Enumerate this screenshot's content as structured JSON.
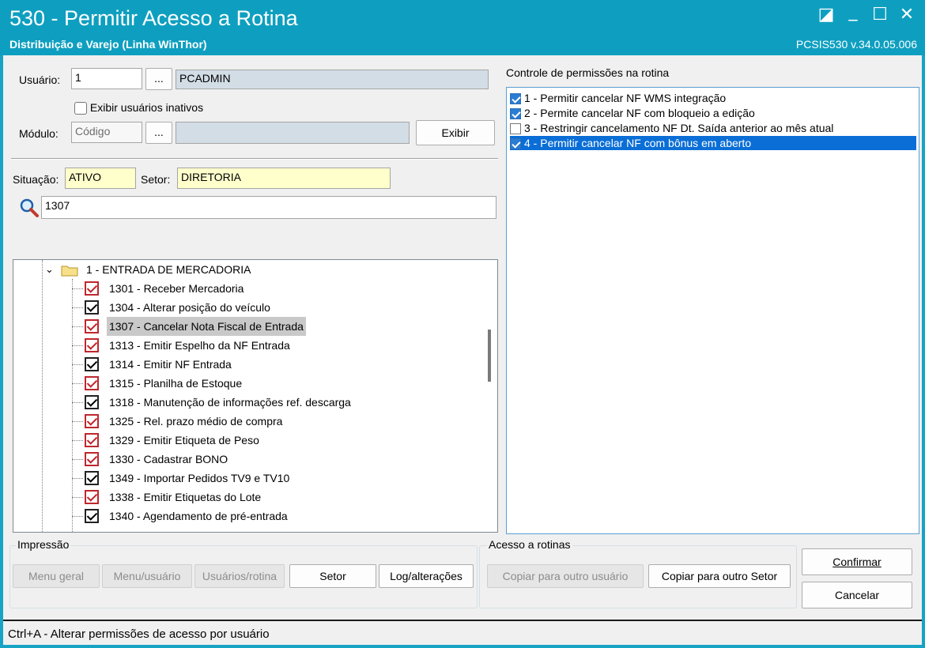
{
  "window": {
    "title": "530 - Permitir Acesso a Rotina",
    "subtitle": "Distribuição e Varejo (Linha WinThor)",
    "version": "PCSIS530  v.34.0.05.006",
    "controls": {
      "restore_icon": "◪",
      "minimize_icon": "_",
      "maximize_icon": "☐",
      "close_icon": "✕"
    }
  },
  "filters": {
    "usuario_label": "Usuário:",
    "usuario_code": "1",
    "ellipsis": "...",
    "usuario_name": "PCADMIN",
    "inactive_label": "Exibir usuários inativos",
    "modulo_label": "Módulo:",
    "modulo_placeholder": "Código",
    "modulo_name": "",
    "exibir_button": "Exibir",
    "situacao_label": "Situação:",
    "situacao_value": "ATIVO",
    "setor_label": "Setor:",
    "setor_value": "DIRETORIA",
    "search_value": "1307"
  },
  "tree": {
    "folder_label": "1 - ENTRADA DE MERCADORIA",
    "items": [
      {
        "label": "1301 - Receber Mercadoria",
        "style": "red"
      },
      {
        "label": "1304 - Alterar posição do veículo",
        "style": "black"
      },
      {
        "label": "1307 - Cancelar Nota Fiscal de  Entrada",
        "style": "red"
      },
      {
        "label": "1313 - Emitir Espelho da NF Entrada",
        "style": "red"
      },
      {
        "label": "1314 - Emitir NF Entrada",
        "style": "black"
      },
      {
        "label": "1315 - Planilha de Estoque",
        "style": "red"
      },
      {
        "label": "1318 - Manutenção de informações ref. descarga",
        "style": "black"
      },
      {
        "label": "1325 - Rel. prazo médio de compra",
        "style": "red"
      },
      {
        "label": "1329 - Emitir Etiqueta de Peso",
        "style": "red"
      },
      {
        "label": "1330 - Cadastrar BONO",
        "style": "red"
      },
      {
        "label": "1349 - Importar Pedidos TV9 e TV10",
        "style": "black"
      },
      {
        "label": "1338 - Emitir Etiquetas do Lote",
        "style": "red"
      },
      {
        "label": "1340 - Agendamento de pré-entrada",
        "style": "black"
      }
    ]
  },
  "permissions": {
    "title": "Controle de permissões na rotina",
    "items": [
      {
        "label": "1 - Permitir cancelar NF WMS integração",
        "checked": true
      },
      {
        "label": "2 - Permite cancelar NF com bloqueio a edição",
        "checked": true
      },
      {
        "label": "3 - Restringir cancelamento NF Dt. Saída anterior ao mês atual",
        "checked": false
      },
      {
        "label": "4 - Permitir cancelar NF com bônus em aberto",
        "checked": true
      }
    ]
  },
  "impressao": {
    "title": "Impressão",
    "menu_geral": "Menu geral",
    "menu_usuario": "Menu/usuário",
    "usuarios_rotina": "Usuários/rotina",
    "setor": "Setor",
    "log": "Log/alterações"
  },
  "acesso": {
    "title": "Acesso a rotinas",
    "copiar_usuario": "Copiar para outro usuário",
    "copiar_setor": "Copiar para outro Setor"
  },
  "actions": {
    "confirmar": "Confirmar",
    "cancelar": "Cancelar"
  },
  "status": {
    "text": "Ctrl+A - Alterar permissões de acesso por usuário"
  },
  "colors": {
    "titlebar": "#0e9fc0",
    "selection": "#0a6ed6",
    "checked_red": "#c0262d"
  }
}
